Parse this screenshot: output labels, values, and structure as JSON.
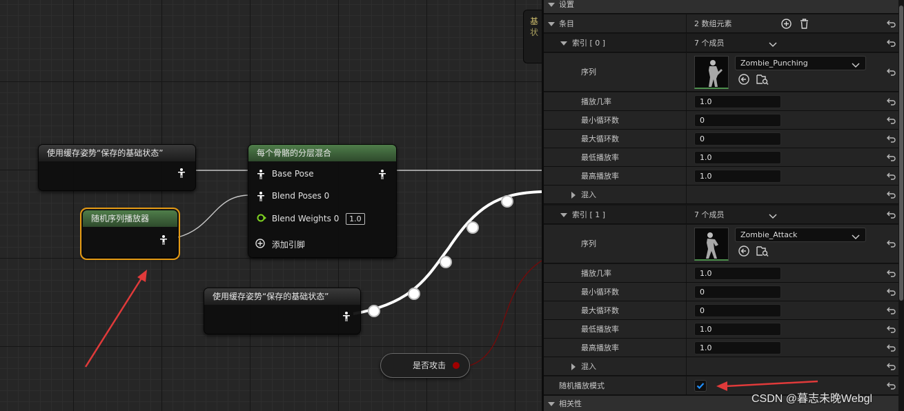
{
  "graph": {
    "cached_pose_node_1": {
      "title": "使用缓存姿势“保存的基础状态”"
    },
    "random_sequence_node": {
      "title": "随机序列播放器"
    },
    "layered_blend_node": {
      "title": "每个骨骼的分层混合",
      "pins": {
        "base_pose": "Base Pose",
        "blend_poses": "Blend Poses 0",
        "blend_weights": "Blend Weights 0",
        "blend_weights_value": "1.0",
        "add_pin": "添加引脚"
      }
    },
    "cached_pose_node_2": {
      "title": "使用缓存姿势“保存的基础状态”"
    },
    "bool_node": {
      "label": "是否攻击"
    },
    "partial_node": {
      "line1": "基",
      "line2": "状"
    }
  },
  "panel": {
    "settings_category": "设置",
    "entries": {
      "label": "条目",
      "value": "2 数组元素"
    },
    "items": [
      {
        "index_label": "索引 [ 0 ]",
        "members": "7 个成员",
        "sequence_label": "序列",
        "sequence_value": "Zombie_Punching",
        "play_rate_label": "播放几率",
        "play_rate": "1.0",
        "min_loops_label": "最小循环数",
        "min_loops": "0",
        "max_loops_label": "最大循环数",
        "max_loops": "0",
        "min_rate_label": "最低播放率",
        "min_rate": "1.0",
        "max_rate_label": "最高播放率",
        "max_rate": "1.0",
        "blend_label": "混入"
      },
      {
        "index_label": "索引 [ 1 ]",
        "members": "7 个成员",
        "sequence_label": "序列",
        "sequence_value": "Zombie_Attack",
        "play_rate_label": "播放几率",
        "play_rate": "1.0",
        "min_loops_label": "最小循环数",
        "min_loops": "0",
        "max_loops_label": "最大循环数",
        "max_loops": "0",
        "min_rate_label": "最低播放率",
        "min_rate": "1.0",
        "max_rate_label": "最高播放率",
        "max_rate": "1.0",
        "blend_label": "混入"
      }
    ],
    "random_mode_label": "随机播放模式",
    "random_mode_checked": true,
    "relevance_category": "相关性"
  },
  "watermark": "CSDN @暮志未晚Webgl",
  "colors": {
    "selection": "#e59a12",
    "annotation_arrow": "#e03a3a",
    "bool_pin": "#a00000",
    "check": "#1f8fff",
    "node_header_green": "#4f7d4a"
  }
}
